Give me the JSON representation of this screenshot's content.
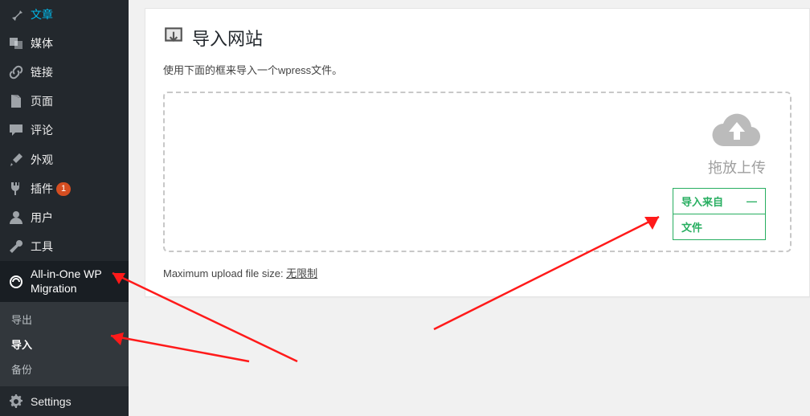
{
  "sidebar": {
    "items": [
      {
        "icon": "pin",
        "label": "文章"
      },
      {
        "icon": "media",
        "label": "媒体"
      },
      {
        "icon": "link",
        "label": "链接"
      },
      {
        "icon": "page",
        "label": "页面"
      },
      {
        "icon": "comment",
        "label": "评论"
      },
      {
        "icon": "brush",
        "label": "外观"
      },
      {
        "icon": "plug",
        "label": "插件",
        "badge": "1"
      },
      {
        "icon": "user",
        "label": "用户"
      },
      {
        "icon": "wrench",
        "label": "工具"
      },
      {
        "icon": "aiom",
        "label": "All-in-One WP Migration"
      },
      {
        "icon": "cog",
        "label": "Settings"
      }
    ],
    "submenu": {
      "export": "导出",
      "import": "导入",
      "backups": "备份"
    }
  },
  "page": {
    "title": "导入网站",
    "desc": "使用下面的框来导入一个wpress文件。",
    "drop_label": "拖放上传",
    "import_from": "导入来自",
    "import_file": "文件",
    "max_prefix": "Maximum upload file size: ",
    "max_value": "无限制"
  }
}
